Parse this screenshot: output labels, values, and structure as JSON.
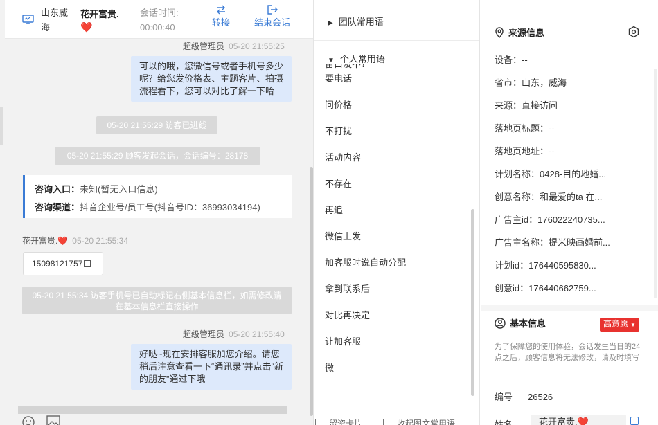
{
  "header": {
    "visitor_location": "山东威海",
    "visitor_name": "花开富贵.",
    "visitor_emoji": "❤️",
    "session_time_label": "会话时间:",
    "session_time_value": "00:00:40",
    "transfer_label": "转接",
    "end_label": "结束会话"
  },
  "chat": {
    "msg1_sender": "超级管理员",
    "msg1_time": "05-20 21:55:25",
    "msg1_text": "可以的哦，您微信号或者手机号多少呢？给您发价格表、主题客片、拍摄流程看下，您可以对比了解一下哈",
    "sys1": "05-20 21:55:29 访客已进线",
    "sys2": "05-20 21:55:29 顾客发起会话，会话编号：28178",
    "card_entry_label": "咨询入口：",
    "card_entry_value": "未知(暂无入口信息)",
    "card_channel_label": "咨询渠道：",
    "card_channel_value": "抖音企业号/员工号(抖音号ID：36993034194)",
    "visitor_msg_sender": "花开富贵.",
    "visitor_msg_time": "05-20 21:55:34",
    "visitor_msg_text": "15098121757",
    "sys3": "05-20 21:55:34 访客手机号已自动标记右侧基本信息栏，如需修改请在基本信息栏直接操作",
    "msg2_sender": "超级管理员",
    "msg2_time": "05-20 21:55:40",
    "msg2_text": "好哒~现在安排客服加您介绍。请您稍后注意查看一下“通讯录”并点击“新的朋友”通过下哦"
  },
  "phrases": {
    "team_group": "团队常用语",
    "personal_group": "个人常用语",
    "cut_item": "留白没不?",
    "items": [
      "要电话",
      "问价格",
      "不打扰",
      "活动内容",
      "不存在",
      "再追",
      "微信上发",
      "加客服时说自动分配",
      "拿到联系后",
      "对比再决定",
      "让加客服",
      "微"
    ],
    "footer_left": "留资卡片",
    "footer_right": "收起图文常用语"
  },
  "source_info": {
    "title": "来源信息",
    "device_label": "设备：",
    "device_value": "--",
    "province_label": "省市：",
    "province_value": "山东，威海",
    "source_label": "来源：",
    "source_value": "直接访问",
    "landing_title_label": "落地页标题：",
    "landing_title_value": "--",
    "landing_url_label": "落地页地址：",
    "landing_url_value": "--",
    "plan_label": "计划名称：",
    "plan_value": "0428-目的地婚...",
    "creative_label": "创意名称：",
    "creative_value": "和最爱的ta 在...",
    "adv_id_label": "广告主id：",
    "adv_id_value": "176022240735...",
    "adv_name_label": "广告主名称：",
    "adv_name_value": "提米映画婚前...",
    "plan_id_label": "计划id：",
    "plan_id_value": "176440595830...",
    "creative_id_label": "创意id：",
    "creative_id_value": "176440662759..."
  },
  "basic_info": {
    "title": "基本信息",
    "intent_badge": "高意愿",
    "notice": "为了保障您的使用体验，会话发生当日的24点之后，顾客信息将无法修改，请及时填写",
    "number_label": "编号",
    "number_value": "26526",
    "name_label": "姓名",
    "name_value": "花开富贵."
  },
  "colors": {
    "accent": "#3a7bd5",
    "agent_bubble": "#dde9fb",
    "system_pill": "#d9d9d9",
    "badge_red": "#e8322f"
  }
}
